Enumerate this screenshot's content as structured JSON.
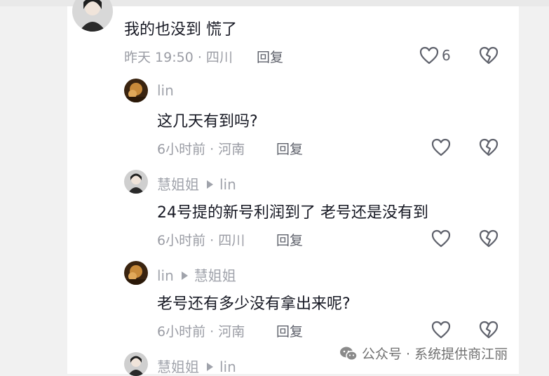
{
  "comments": [
    {
      "text": "我的也没到 慌了",
      "meta": "昨天 19:50 · 四川",
      "reply_label": "回复",
      "like_count": "6"
    }
  ],
  "replies": [
    {
      "user": "lin",
      "reply_to": "",
      "text": "这几天有到吗?",
      "meta": "6小时前 · 河南",
      "reply_label": "回复"
    },
    {
      "user": "慧姐姐",
      "reply_to": "lin",
      "text": "24号提的新号利润到了 老号还是没有到",
      "meta": "6小时前 · 四川",
      "reply_label": "回复"
    },
    {
      "user": "lin",
      "reply_to": "慧姐姐",
      "text": "老号还有多少没有拿出来呢?",
      "meta": "6小时前 · 河南",
      "reply_label": "回复"
    },
    {
      "user": "慧姐姐",
      "reply_to": "lin"
    }
  ],
  "watermark": {
    "text": "公众号 · 系统提供商江丽"
  },
  "colors": {
    "primary_text": "#161823",
    "secondary_text": "#9a9ca4",
    "background": "#ffffff"
  },
  "icons": [
    "heart-icon",
    "broken-heart-icon",
    "wechat-icon"
  ]
}
